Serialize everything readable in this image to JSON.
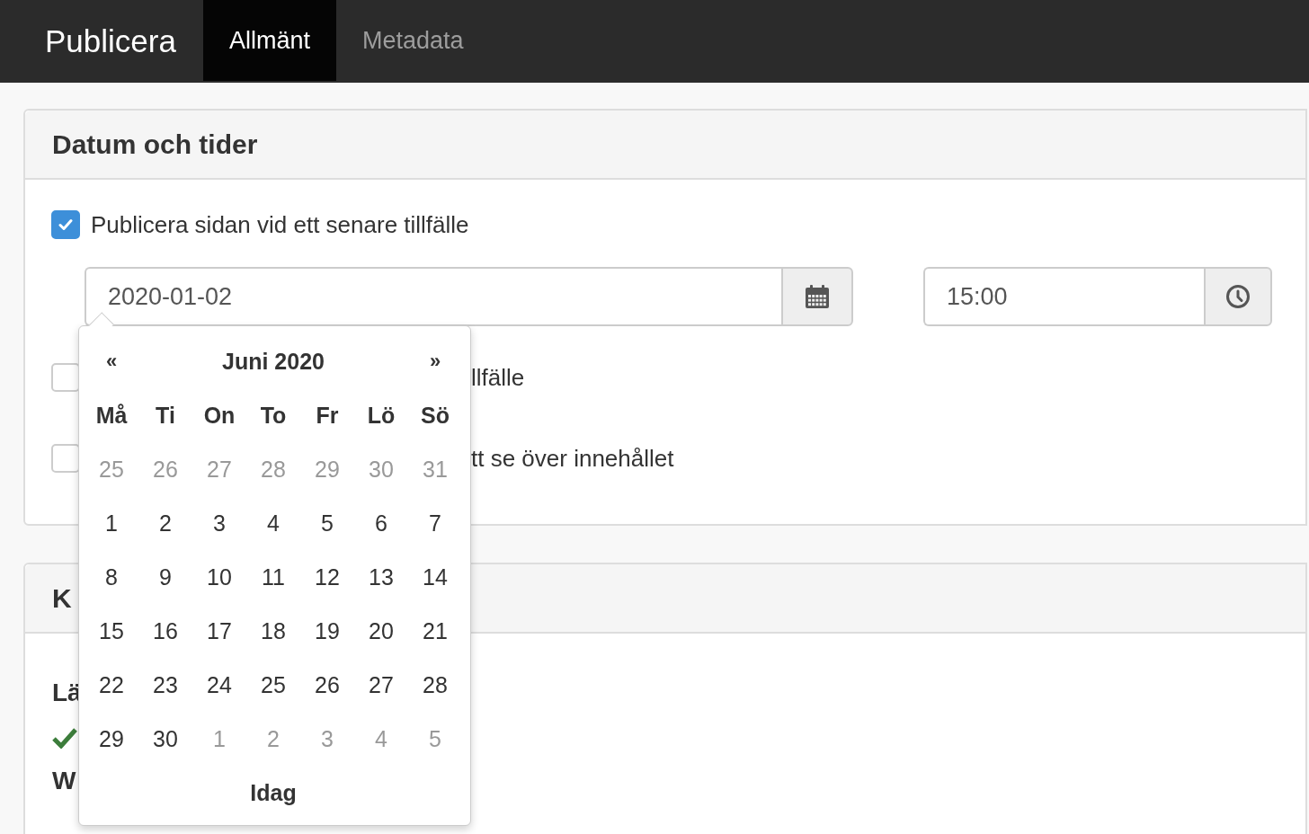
{
  "navbar": {
    "brand": "Publicera",
    "tabs": [
      {
        "label": "Allmänt",
        "selected": true
      },
      {
        "label": "Metadata",
        "selected": false
      }
    ]
  },
  "date_panel": {
    "title": "Datum och tider",
    "options": [
      {
        "label": "Publicera sidan vid ett senare tillfälle",
        "checked": true
      },
      {
        "label": "llfälle",
        "checked": false
      },
      {
        "label": "tt se över innehållet",
        "checked": false
      }
    ],
    "date_field": {
      "value": "2020-01-02"
    },
    "time_field": {
      "value": "15:00"
    }
  },
  "second_panel": {
    "title": "K",
    "items": [
      {
        "kind": "label",
        "text": "Lä"
      },
      {
        "kind": "check"
      },
      {
        "kind": "label",
        "text": "W"
      }
    ]
  },
  "datepicker": {
    "prev": "«",
    "month": "Juni 2020",
    "next": "»",
    "weekdays": [
      "Må",
      "Ti",
      "On",
      "To",
      "Fr",
      "Lö",
      "Sö"
    ],
    "weeks": [
      [
        {
          "day": "25",
          "muted": true
        },
        {
          "day": "26",
          "muted": true
        },
        {
          "day": "27",
          "muted": true
        },
        {
          "day": "28",
          "muted": true
        },
        {
          "day": "29",
          "muted": true
        },
        {
          "day": "30",
          "muted": true
        },
        {
          "day": "31",
          "muted": true
        }
      ],
      [
        {
          "day": "1",
          "muted": false
        },
        {
          "day": "2",
          "muted": false
        },
        {
          "day": "3",
          "muted": false
        },
        {
          "day": "4",
          "muted": false
        },
        {
          "day": "5",
          "muted": false
        },
        {
          "day": "6",
          "muted": false
        },
        {
          "day": "7",
          "muted": false
        }
      ],
      [
        {
          "day": "8",
          "muted": false
        },
        {
          "day": "9",
          "muted": false
        },
        {
          "day": "10",
          "muted": false
        },
        {
          "day": "11",
          "muted": false
        },
        {
          "day": "12",
          "muted": false
        },
        {
          "day": "13",
          "muted": false
        },
        {
          "day": "14",
          "muted": false
        }
      ],
      [
        {
          "day": "15",
          "muted": false
        },
        {
          "day": "16",
          "muted": false
        },
        {
          "day": "17",
          "muted": false
        },
        {
          "day": "18",
          "muted": false
        },
        {
          "day": "19",
          "muted": false
        },
        {
          "day": "20",
          "muted": false
        },
        {
          "day": "21",
          "muted": false
        }
      ],
      [
        {
          "day": "22",
          "muted": false
        },
        {
          "day": "23",
          "muted": false
        },
        {
          "day": "24",
          "muted": false
        },
        {
          "day": "25",
          "muted": false
        },
        {
          "day": "26",
          "muted": false
        },
        {
          "day": "27",
          "muted": false
        },
        {
          "day": "28",
          "muted": false
        }
      ],
      [
        {
          "day": "29",
          "muted": false
        },
        {
          "day": "30",
          "muted": false
        },
        {
          "day": "1",
          "muted": true
        },
        {
          "day": "2",
          "muted": true
        },
        {
          "day": "3",
          "muted": true
        },
        {
          "day": "4",
          "muted": true
        },
        {
          "day": "5",
          "muted": true
        }
      ]
    ],
    "today": "Idag"
  }
}
